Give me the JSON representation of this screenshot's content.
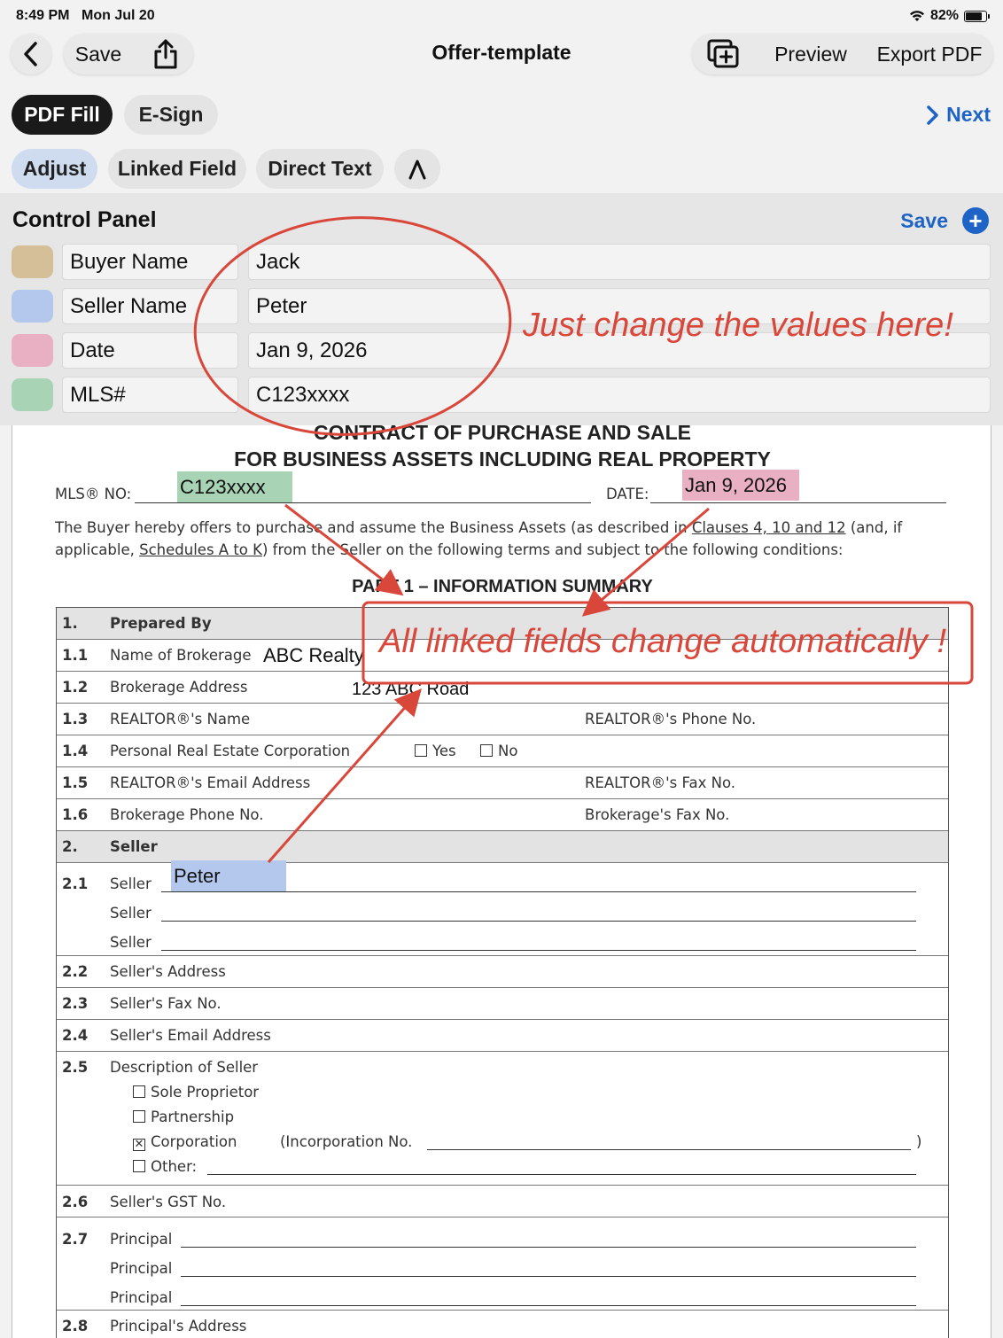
{
  "status_bar": {
    "time": "8:49 PM",
    "date": "Mon Jul 20",
    "battery": "82%"
  },
  "nav": {
    "save": "Save",
    "title": "Offer-template",
    "preview": "Preview",
    "export": "Export PDF"
  },
  "modes": {
    "pdf_fill": "PDF Fill",
    "esign": "E-Sign",
    "next": "Next"
  },
  "tools": {
    "adjust": "Adjust",
    "linked_field": "Linked Field",
    "direct_text": "Direct Text"
  },
  "control_panel": {
    "title": "Control Panel",
    "save": "Save",
    "fields": [
      {
        "name": "Buyer Name",
        "value": "Jack",
        "color": "#d4bf99"
      },
      {
        "name": "Seller Name",
        "value": "Peter",
        "color": "#b3c8ec"
      },
      {
        "name": "Date",
        "value": "Jan 9, 2026",
        "color": "#e9b0c3"
      },
      {
        "name": "MLS#",
        "value": "C123xxxx",
        "color": "#a8d4b5"
      }
    ]
  },
  "annotations": {
    "panel_note": "Just change the values here!",
    "linked_note": "All linked fields change automatically !"
  },
  "document": {
    "heading1": "CONTRACT OF PURCHASE AND SALE",
    "heading2": "FOR BUSINESS ASSETS INCLUDING REAL PROPERTY",
    "mls_label": "MLS® NO:",
    "mls_value": "C123xxxx",
    "date_label": "DATE:",
    "date_value": "Jan 9, 2026",
    "para1_a": "The Buyer hereby offers to purchase and assume the Business Assets (as described in",
    "para1_link": "Clauses 4, 10 and 12",
    "para1_b": "(and, if",
    "para2_a": "applicable,",
    "para2_link": "Schedules A to K",
    "para2_b": ") from the Seller on the following terms and subject to the following conditions:",
    "part_heading": "PART 1 – INFORMATION SUMMARY",
    "rows": {
      "r1_num": "1.",
      "r1_label": "Prepared By",
      "r11_num": "1.1",
      "r11_label": "Name of Brokerage",
      "r11_value": "ABC Realty",
      "r12_num": "1.2",
      "r12_label": "Brokerage Address",
      "r12_value": "123 ABC Road",
      "r13_num": "1.3",
      "r13_label": "REALTOR®'s Name",
      "r13_right": "REALTOR®'s Phone No.",
      "r14_num": "1.4",
      "r14_label": "Personal Real Estate Corporation",
      "r14_yes": "Yes",
      "r14_no": "No",
      "r15_num": "1.5",
      "r15_label": "REALTOR®'s Email Address",
      "r15_right": "REALTOR®'s Fax No.",
      "r16_num": "1.6",
      "r16_label": "Brokerage Phone No.",
      "r16_right": "Brokerage's Fax No.",
      "r2_num": "2.",
      "r2_label": "Seller",
      "r21_num": "2.1",
      "r21_label1": "Seller",
      "r21_value": "Peter",
      "r21_label2": "Seller",
      "r21_label3": "Seller",
      "r22_num": "2.2",
      "r22_label": "Seller's Address",
      "r23_num": "2.3",
      "r23_label": "Seller's Fax No.",
      "r24_num": "2.4",
      "r24_label": "Seller's Email Address",
      "r25_num": "2.5",
      "r25_label": "Description of Seller",
      "r25_opt1": "Sole Proprietor",
      "r25_opt2": "Partnership",
      "r25_opt3": "Corporation",
      "r25_inc": "(Incorporation No.",
      "r25_close": ")",
      "r25_opt4": "Other:",
      "r26_num": "2.6",
      "r26_label": "Seller's GST No.",
      "r27_num": "2.7",
      "r27_label1": "Principal",
      "r27_label2": "Principal",
      "r27_label3": "Principal",
      "r28_num": "2.8",
      "r28_label": "Principal's Address"
    }
  }
}
